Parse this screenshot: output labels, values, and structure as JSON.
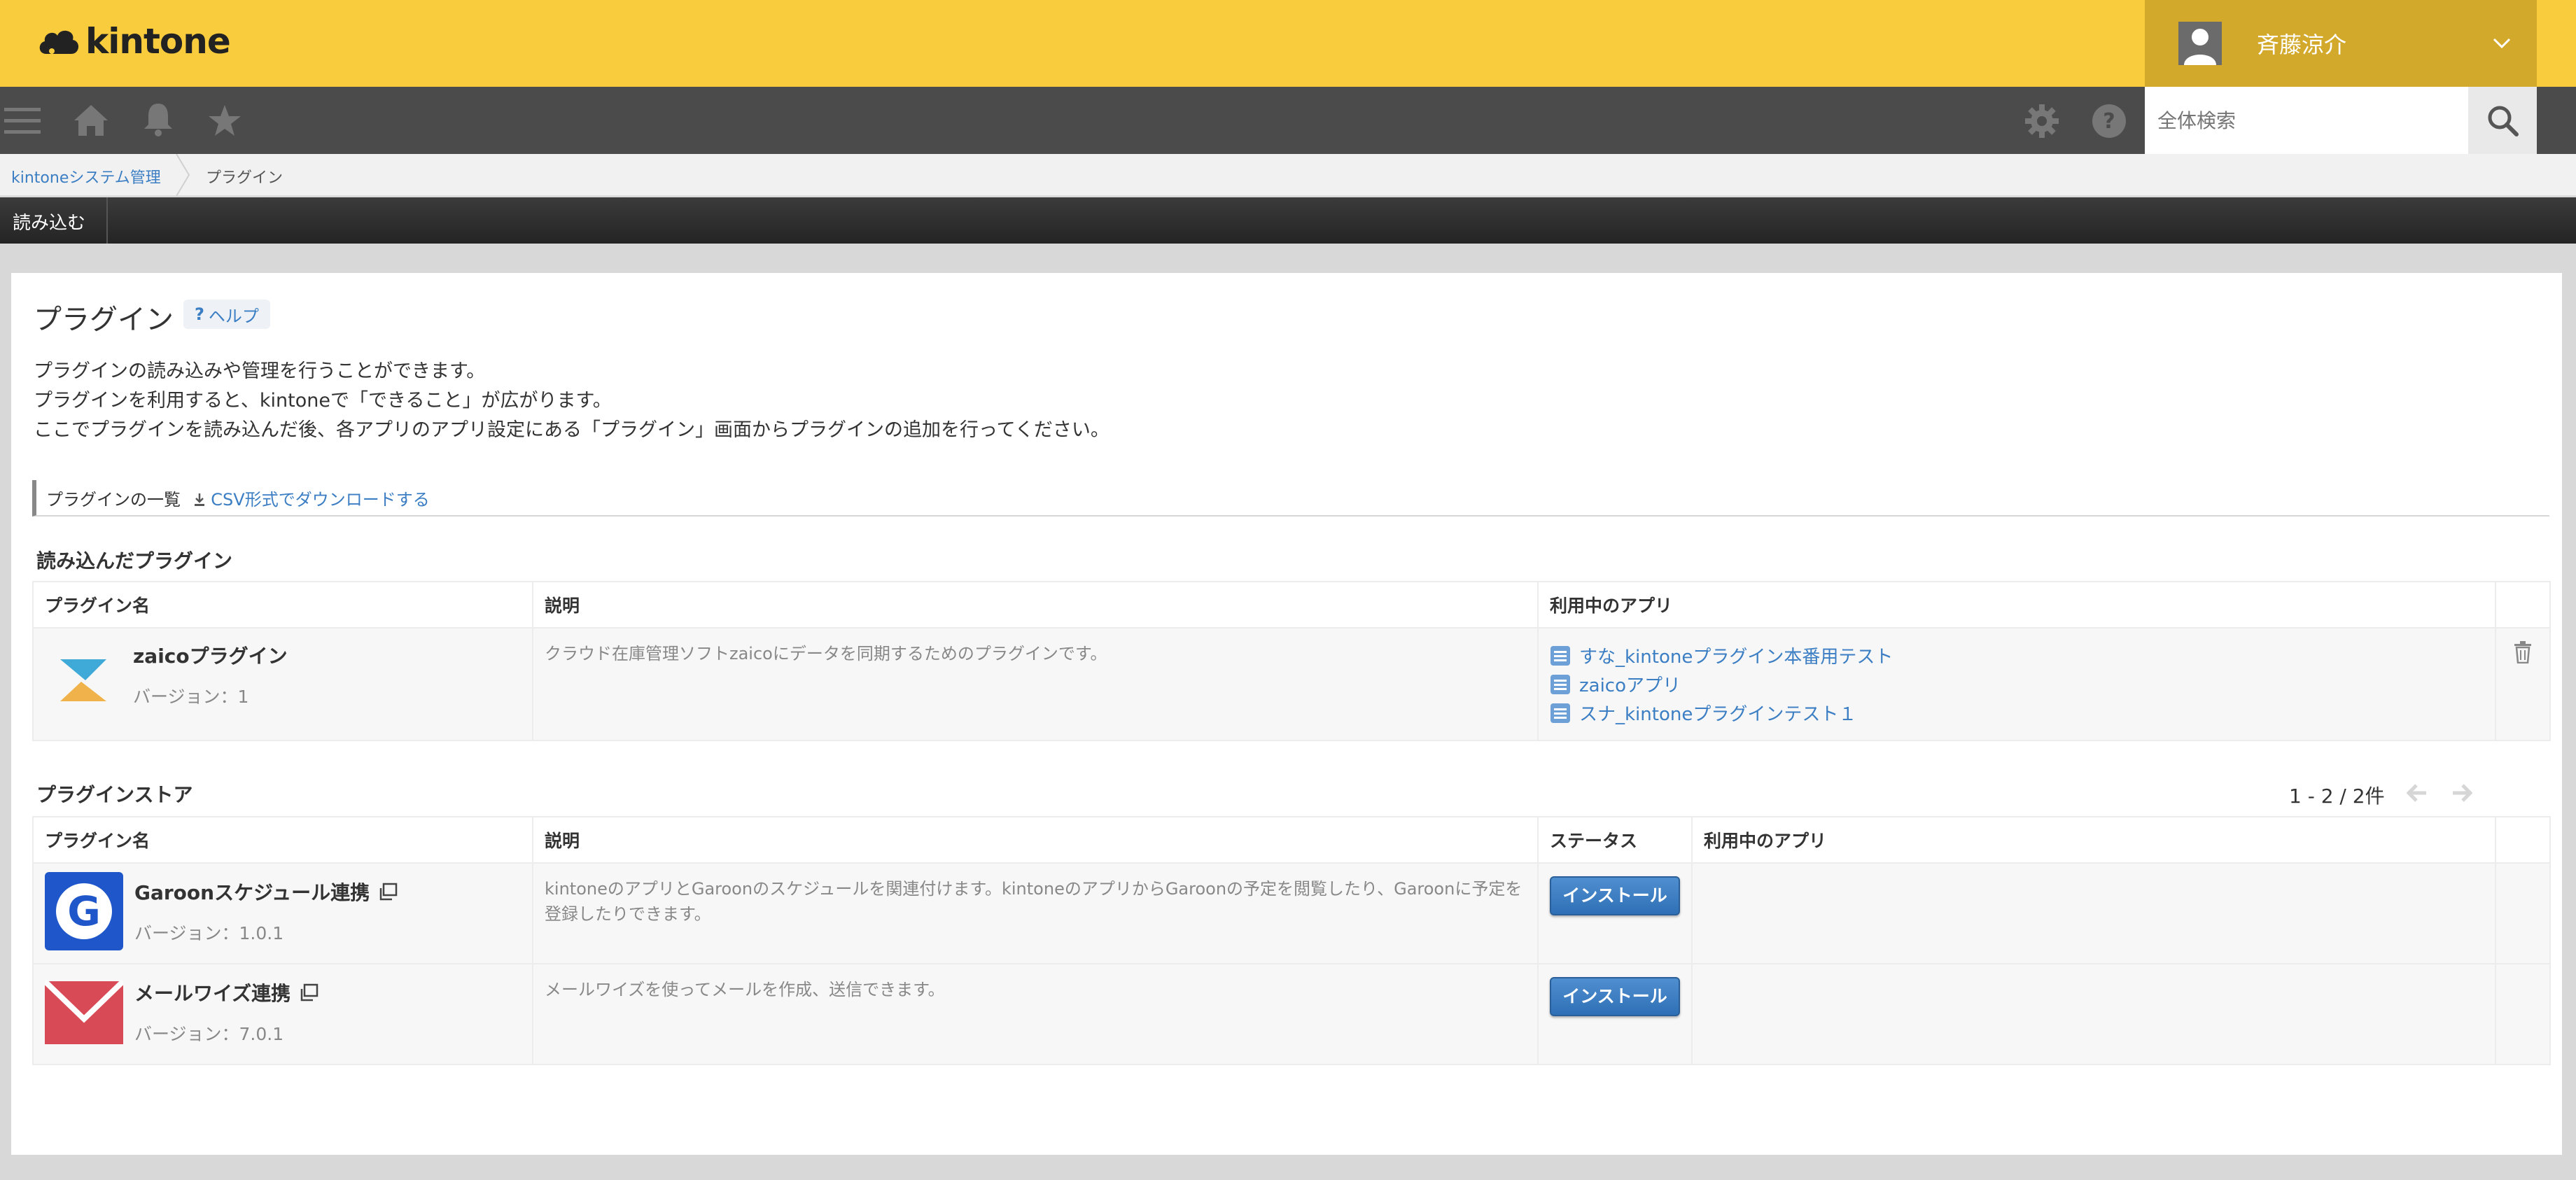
{
  "header": {
    "logo_text": "kintone",
    "user_name": "斉藤涼介"
  },
  "nav": {
    "search_placeholder": "全体検索"
  },
  "breadcrumb": {
    "items": [
      "kintoneシステム管理",
      "プラグイン"
    ]
  },
  "toolbar": {
    "import_label": "読み込む"
  },
  "page": {
    "title": "プラグイン",
    "help_label": "ヘルプ",
    "description": [
      "プラグインの読み込みや管理を行うことができます。",
      "プラグインを利用すると、kintoneで「できること」が広がります。",
      "ここでプラグインを読み込んだ後、各アプリのアプリ設定にある「プラグイン」画面からプラグインの追加を行ってください。"
    ],
    "list_title": "プラグインの一覧",
    "csv_download_label": "CSV形式でダウンロードする"
  },
  "loaded_plugins": {
    "section_title": "読み込んだプラグイン",
    "columns": [
      "プラグイン名",
      "説明",
      "利用中のアプリ"
    ],
    "rows": [
      {
        "name": "zaicoプラグイン",
        "version": "バージョン：1",
        "description": "クラウド在庫管理ソフトzaicoにデータを同期するためのプラグインです。",
        "apps": [
          "すな_kintoneプラグイン本番用テスト",
          "zaicoアプリ",
          "スナ_kintoneプラグインテスト１"
        ]
      }
    ]
  },
  "store": {
    "section_title": "プラグインストア",
    "pager_text": "1 - 2 / 2件",
    "columns": [
      "プラグイン名",
      "説明",
      "ステータス",
      "利用中のアプリ"
    ],
    "install_label": "インストール",
    "rows": [
      {
        "name": "Garoonスケジュール連携",
        "version": "バージョン：1.0.1",
        "description": "kintoneのアプリとGaroonのスケジュールを関連付けます。kintoneのアプリからGaroonの予定を閲覧したり、Garoonに予定を登録したりできます。"
      },
      {
        "name": "メールワイズ連携",
        "version": "バージョン：7.0.1",
        "description": "メールワイズを使ってメールを作成、送信できます。"
      }
    ]
  },
  "colors": {
    "header_yellow": "#f9cc3e",
    "user_box": "#d3a92b",
    "nav_dark": "#4b4b4b",
    "link_blue": "#3b7ec3",
    "install_blue": "#2f6fb5"
  }
}
